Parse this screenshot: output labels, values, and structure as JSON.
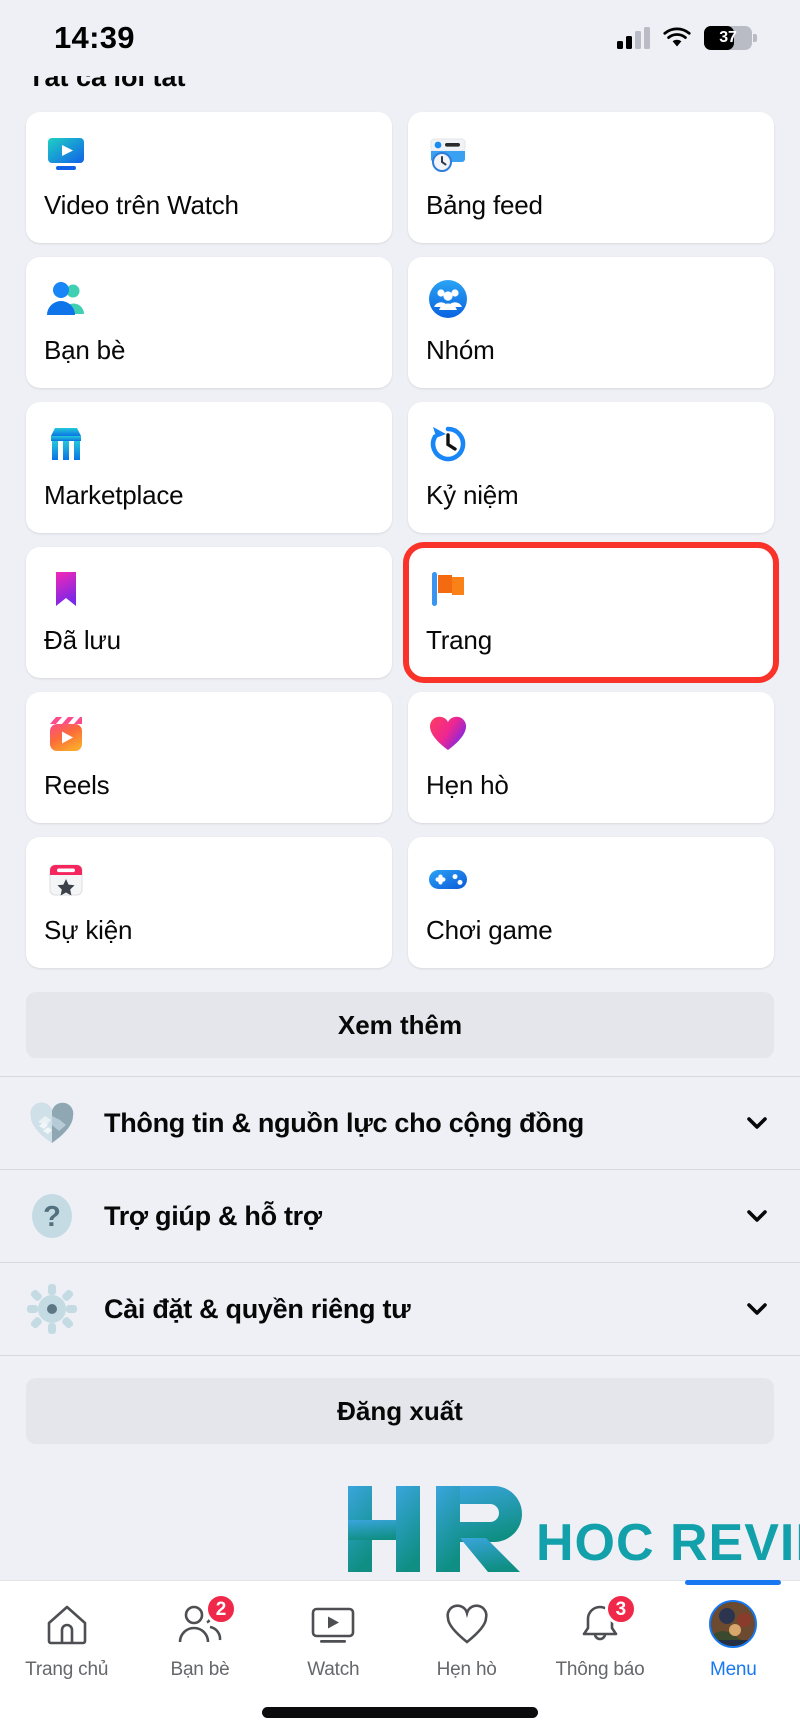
{
  "status_bar": {
    "time": "14:39",
    "battery_percent": "37",
    "icons": [
      "cellular-signal-icon",
      "wifi-icon",
      "battery-icon"
    ]
  },
  "section_header_cut": "Tất cả lối tắt",
  "shortcuts": [
    {
      "label": "Video trên Watch",
      "icon": "watch-video-icon",
      "highlighted": false
    },
    {
      "label": "Bảng feed",
      "icon": "feeds-icon",
      "highlighted": false
    },
    {
      "label": "Bạn bè",
      "icon": "friends-icon",
      "highlighted": false
    },
    {
      "label": "Nhóm",
      "icon": "groups-icon",
      "highlighted": false
    },
    {
      "label": "Marketplace",
      "icon": "marketplace-icon",
      "highlighted": false
    },
    {
      "label": "Kỷ niệm",
      "icon": "memories-icon",
      "highlighted": false
    },
    {
      "label": "Đã lưu",
      "icon": "saved-bookmark-icon",
      "highlighted": false
    },
    {
      "label": "Trang",
      "icon": "pages-flag-icon",
      "highlighted": true
    },
    {
      "label": "Reels",
      "icon": "reels-icon",
      "highlighted": false
    },
    {
      "label": "Hẹn hò",
      "icon": "dating-heart-icon",
      "highlighted": false
    },
    {
      "label": "Sự kiện",
      "icon": "events-icon",
      "highlighted": false
    },
    {
      "label": "Chơi game",
      "icon": "gaming-icon",
      "highlighted": false
    }
  ],
  "see_more_label": "Xem thêm",
  "accordion": [
    {
      "label": "Thông tin & nguồn lực cho cộng đồng",
      "icon": "handshake-heart-icon",
      "chevron": "chevron-down-icon"
    },
    {
      "label": "Trợ giúp & hỗ trợ",
      "icon": "question-mark-icon",
      "chevron": "chevron-down-icon"
    },
    {
      "label": "Cài đặt & quyền riêng tư",
      "icon": "gear-icon",
      "chevron": "chevron-down-icon"
    }
  ],
  "logout_label": "Đăng xuất",
  "tab_bar": [
    {
      "label": "Trang chủ",
      "icon": "home-icon",
      "badge": "",
      "active": false
    },
    {
      "label": "Bạn bè",
      "icon": "friends-icon",
      "badge": "2",
      "active": false
    },
    {
      "label": "Watch",
      "icon": "watch-icon",
      "badge": "",
      "active": false
    },
    {
      "label": "Hẹn hò",
      "icon": "dating-icon",
      "badge": "",
      "active": false
    },
    {
      "label": "Thông báo",
      "icon": "notifications-bell-icon",
      "badge": "3",
      "active": false
    },
    {
      "label": "Menu",
      "icon": "avatar-menu-icon",
      "badge": "",
      "active": true
    }
  ],
  "watermark": {
    "mark": "HR",
    "text": "HOC REVIEW"
  },
  "colors": {
    "highlight_border": "#f9332a",
    "facebook_blue": "#1878f2",
    "badge_red": "#f02849",
    "page_bg": "#eef0f5",
    "card_bg": "#ffffff",
    "button_bg": "#e4e6eb"
  }
}
